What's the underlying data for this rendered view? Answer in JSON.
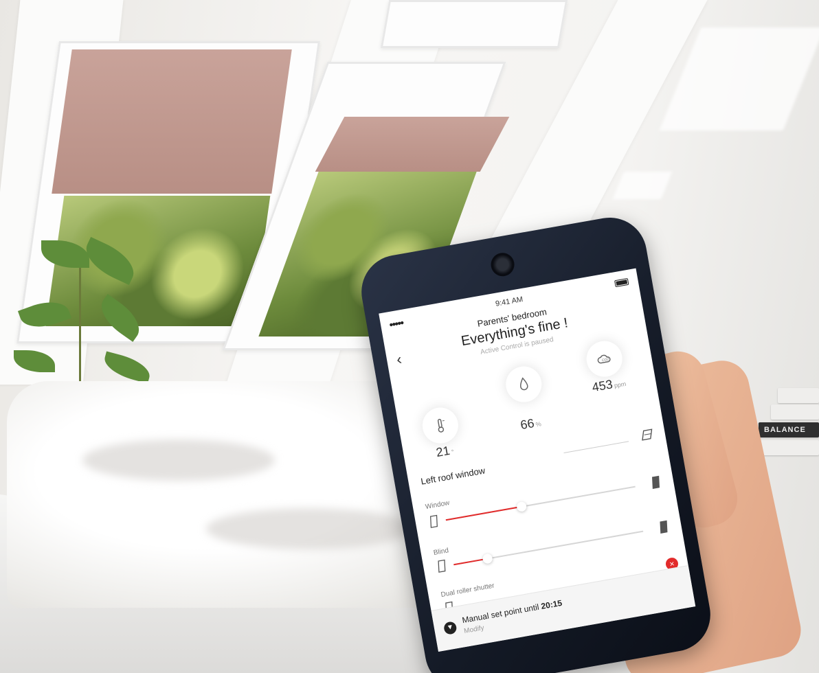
{
  "app": {
    "status_time": "9:41 AM",
    "room_title": "Parents' bedroom",
    "headline": "Everything's fine !",
    "subline": "Active Control is paused"
  },
  "metrics": [
    {
      "id": "temperature",
      "icon": "thermometer-icon",
      "value": "21",
      "unit": "°"
    },
    {
      "id": "humidity",
      "icon": "droplet-icon",
      "value": "66",
      "unit": "%"
    },
    {
      "id": "co2",
      "icon": "co2-cloud-icon",
      "value": "453",
      "unit": "ppm"
    }
  ],
  "section": {
    "title": "Left roof window"
  },
  "controls": {
    "window": {
      "label": "Window",
      "level": 0.4
    },
    "blind": {
      "label": "Blind",
      "level": 0.18
    },
    "shutter": {
      "label": "Dual roller shutter",
      "level": 0.0
    }
  },
  "footer": {
    "main": "Manual set point until ",
    "time": "20:15",
    "sub": "Modify"
  },
  "background": {
    "book_spine_text": "BALANCE"
  },
  "colors": {
    "accent": "#e22b2b",
    "phone_body": "#141a26",
    "blind": "#c9a39a"
  }
}
